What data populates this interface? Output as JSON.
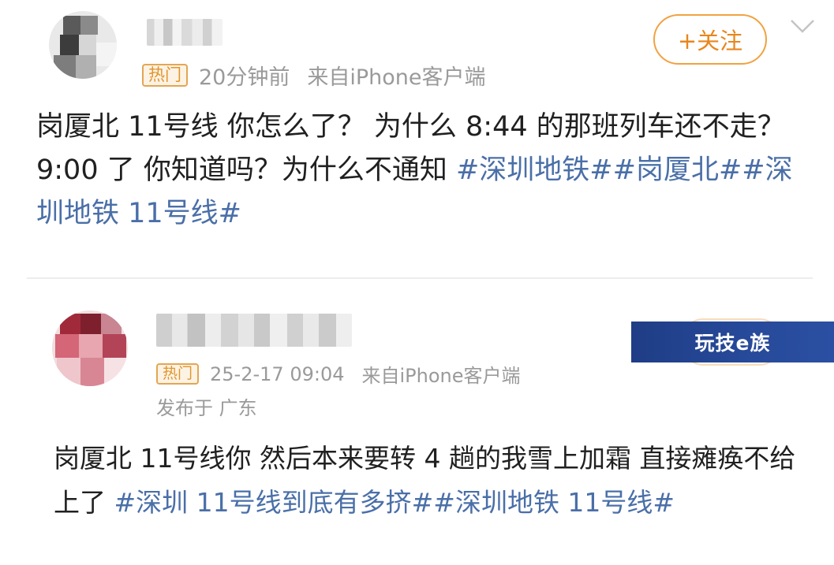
{
  "post1": {
    "hot_badge": "热门",
    "time": "20分钟前",
    "source": "来自iPhone客户端",
    "follow_label": "+关注",
    "content_text": "岗厦北 11号线 你怎么了？ 为什么 8:44 的那班列车还不走？ 9:00 了 你知道吗？为什么不通知 ",
    "hashtags": [
      "#深圳地铁#",
      "#岗厦北#",
      "#深圳地铁 11号线#"
    ]
  },
  "post2": {
    "hot_badge": "热门",
    "time": "25-2-17 09:04",
    "source": "来自iPhone客户端",
    "location": "发布于 广东",
    "content_text": "岗厦北 11号线你 然后本来要转 4 趟的我雪上加霜 直接瘫痪不给上了 ",
    "hashtags": [
      "#深圳 11号线到底有多挤#",
      "#深圳地铁 11号线#"
    ]
  },
  "watermark": {
    "text": "玩技e族"
  },
  "icons": {
    "more": "chevron-down-icon"
  },
  "colors": {
    "hashtag": "#4a6fa8",
    "follow": "#e8861d",
    "badge": "#e0962e",
    "meta": "#9a9a9a"
  }
}
